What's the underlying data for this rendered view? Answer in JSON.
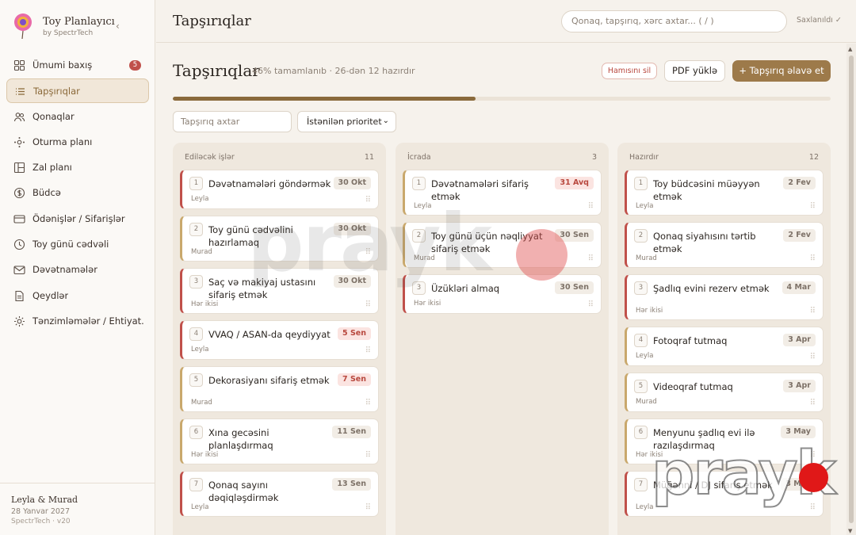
{
  "brand": {
    "name": "Toy Planlayıcı",
    "sub": "by SpectrTech"
  },
  "nav": [
    {
      "label": "Ümumi baxış",
      "badge": "5",
      "icon": "grid-icon"
    },
    {
      "label": "Tapşırıqlar",
      "icon": "list-icon",
      "active": true
    },
    {
      "label": "Qonaqlar",
      "icon": "users-icon"
    },
    {
      "label": "Oturma planı",
      "icon": "seating-icon"
    },
    {
      "label": "Zal planı",
      "icon": "layout-icon"
    },
    {
      "label": "Büdcə",
      "icon": "budget-icon"
    },
    {
      "label": "Ödənişlər / Sifarişlər",
      "icon": "card-icon"
    },
    {
      "label": "Toy günü cədvəli",
      "icon": "clock-icon"
    },
    {
      "label": "Dəvətnamələr",
      "icon": "mail-icon"
    },
    {
      "label": "Qeydlər",
      "icon": "note-icon"
    },
    {
      "label": "Tənzimləmələr / Ehtiyat...",
      "icon": "settings-icon"
    }
  ],
  "footer": {
    "names": "Leyla & Murad",
    "date": "28 Yanvar 2027",
    "version": "SpectrTech · v20"
  },
  "header": {
    "title": "Tapşırıqlar",
    "search_placeholder": "Qonaq, tapşırıq, xərc axtar...  ( / )",
    "saved": "Saxlanıldı ✓"
  },
  "page": {
    "title": "Tapşırıqlar",
    "meta": "46% tamamlanıb · 26-dən 12 hazırdır",
    "progress": 0.46,
    "clear_label": "Hamısını sil",
    "pdf_label": "PDF yüklə",
    "add_label": "+ Tapşırıq əlavə et",
    "filter_placeholder": "Tapşırıq axtar",
    "priority_select": "İstənilən prioritet"
  },
  "columns": [
    {
      "title": "Ediləcək işlər",
      "count": "11",
      "cards": [
        {
          "n": "1",
          "title": "Dəvətnamələri göndərmək",
          "who": "Leyla",
          "date": "30 Okt",
          "due": "later",
          "pri": "hi"
        },
        {
          "n": "2",
          "title": "Toy günü cədvəlini hazırlamaq",
          "who": "Murad",
          "date": "30 Okt",
          "due": "later",
          "pri": "md"
        },
        {
          "n": "3",
          "title": "Saç və makiyaj ustasını sifariş etmək",
          "who": "Hər ikisi",
          "date": "30 Okt",
          "due": "later",
          "pri": "hi"
        },
        {
          "n": "4",
          "title": "VVAQ / ASAN-da qeydiyyat",
          "who": "Leyla",
          "date": "5 Sen",
          "due": "soon",
          "pri": "hi"
        },
        {
          "n": "5",
          "title": "Dekorasiyanı sifariş etmək",
          "who": "Murad",
          "date": "7 Sen",
          "due": "soon",
          "pri": "md"
        },
        {
          "n": "6",
          "title": "Xına gecəsini planlaşdırmaq",
          "who": "Hər ikisi",
          "date": "11 Sen",
          "due": "later",
          "pri": "md"
        },
        {
          "n": "7",
          "title": "Qonaq sayını dəqiqləşdirmək",
          "who": "Leyla",
          "date": "13 Sen",
          "due": "later",
          "pri": "hi"
        }
      ]
    },
    {
      "title": "İcrada",
      "count": "3",
      "cards": [
        {
          "n": "1",
          "title": "Dəvətnamələri sifariş etmək",
          "who": "Leyla",
          "date": "31 Avq",
          "due": "soon",
          "pri": "md"
        },
        {
          "n": "2",
          "title": "Toy günü üçün nəqliyyat sifariş etmək",
          "who": "Murad",
          "date": "30 Sen",
          "due": "later",
          "pri": "md"
        },
        {
          "n": "3",
          "title": "Üzükləri almaq",
          "who": "Hər ikisi",
          "date": "30 Sen",
          "due": "later",
          "pri": "hi"
        }
      ]
    },
    {
      "title": "Hazırdır",
      "count": "12",
      "cards": [
        {
          "n": "1",
          "title": "Toy büdcəsini müəyyən etmək",
          "who": "Leyla",
          "date": "2 Fev",
          "due": "later",
          "pri": "hi"
        },
        {
          "n": "2",
          "title": "Qonaq siyahısını tərtib etmək",
          "who": "Murad",
          "date": "2 Fev",
          "due": "later",
          "pri": "hi"
        },
        {
          "n": "3",
          "title": "Şadlıq evini rezerv etmək",
          "who": "Hər ikisi",
          "date": "4 Mar",
          "due": "later",
          "pri": "hi"
        },
        {
          "n": "4",
          "title": "Fotoqraf tutmaq",
          "who": "Leyla",
          "date": "3 Apr",
          "due": "later",
          "pri": "md"
        },
        {
          "n": "5",
          "title": "Videoqraf tutmaq",
          "who": "Murad",
          "date": "3 Apr",
          "due": "later",
          "pri": "md"
        },
        {
          "n": "6",
          "title": "Menyunu şadlıq evi ilə razılaşdırmaq",
          "who": "Hər ikisi",
          "date": "3 May",
          "due": "later",
          "pri": "md"
        },
        {
          "n": "7",
          "title": "Müğənni / DJ sifariş etmək",
          "who": "Leyla",
          "date": "3 May",
          "due": "later",
          "pri": "hi"
        }
      ]
    }
  ],
  "watermark": "prayk"
}
